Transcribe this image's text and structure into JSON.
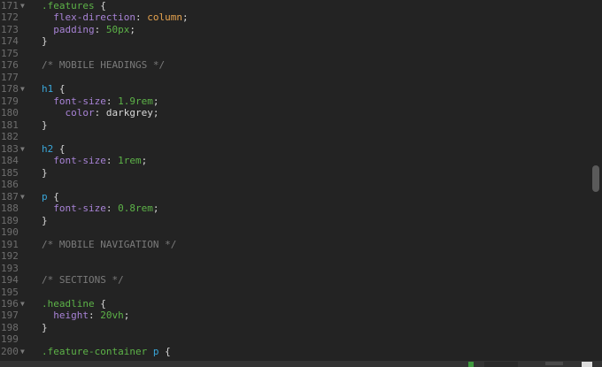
{
  "editor": {
    "lines": [
      {
        "n": "171",
        "fold": true,
        "tokens": [
          [
            "sel",
            ".features"
          ],
          [
            "pn",
            " {"
          ]
        ]
      },
      {
        "n": "172",
        "tokens": [
          [
            "pn",
            "  "
          ],
          [
            "prop",
            "flex-direction"
          ],
          [
            "pn",
            ": "
          ],
          [
            "kw",
            "column"
          ],
          [
            "pn",
            ";"
          ]
        ]
      },
      {
        "n": "173",
        "tokens": [
          [
            "pn",
            "  "
          ],
          [
            "prop",
            "padding"
          ],
          [
            "pn",
            ": "
          ],
          [
            "num",
            "50px"
          ],
          [
            "pn",
            ";"
          ]
        ]
      },
      {
        "n": "174",
        "tokens": [
          [
            "pn",
            "}"
          ]
        ]
      },
      {
        "n": "175",
        "tokens": []
      },
      {
        "n": "176",
        "tokens": [
          [
            "cm",
            "/* MOBILE HEADINGS */"
          ]
        ]
      },
      {
        "n": "177",
        "tokens": []
      },
      {
        "n": "178",
        "fold": true,
        "tokens": [
          [
            "tag",
            "h1"
          ],
          [
            "pn",
            " {"
          ]
        ]
      },
      {
        "n": "179",
        "tokens": [
          [
            "pn",
            "  "
          ],
          [
            "prop",
            "font-size"
          ],
          [
            "pn",
            ": "
          ],
          [
            "num",
            "1.9rem"
          ],
          [
            "pn",
            ";"
          ]
        ]
      },
      {
        "n": "180",
        "tokens": [
          [
            "pn",
            "    "
          ],
          [
            "prop",
            "color"
          ],
          [
            "pn",
            ": darkgrey;"
          ]
        ]
      },
      {
        "n": "181",
        "tokens": [
          [
            "pn",
            "}"
          ]
        ]
      },
      {
        "n": "182",
        "tokens": []
      },
      {
        "n": "183",
        "fold": true,
        "tokens": [
          [
            "tag",
            "h2"
          ],
          [
            "pn",
            " {"
          ]
        ]
      },
      {
        "n": "184",
        "tokens": [
          [
            "pn",
            "  "
          ],
          [
            "prop",
            "font-size"
          ],
          [
            "pn",
            ": "
          ],
          [
            "num",
            "1rem"
          ],
          [
            "pn",
            ";"
          ]
        ]
      },
      {
        "n": "185",
        "tokens": [
          [
            "pn",
            "}"
          ]
        ]
      },
      {
        "n": "186",
        "tokens": []
      },
      {
        "n": "187",
        "fold": true,
        "tokens": [
          [
            "tag",
            "p"
          ],
          [
            "pn",
            " {"
          ]
        ]
      },
      {
        "n": "188",
        "tokens": [
          [
            "pn",
            "  "
          ],
          [
            "prop",
            "font-size"
          ],
          [
            "pn",
            ": "
          ],
          [
            "num",
            "0.8rem"
          ],
          [
            "pn",
            ";"
          ]
        ]
      },
      {
        "n": "189",
        "tokens": [
          [
            "pn",
            "}"
          ]
        ]
      },
      {
        "n": "190",
        "tokens": []
      },
      {
        "n": "191",
        "tokens": [
          [
            "cm",
            "/* MOBILE NAVIGATION */"
          ]
        ]
      },
      {
        "n": "192",
        "tokens": []
      },
      {
        "n": "193",
        "tokens": []
      },
      {
        "n": "194",
        "tokens": [
          [
            "cm",
            "/* SECTIONS */"
          ]
        ]
      },
      {
        "n": "195",
        "tokens": []
      },
      {
        "n": "196",
        "fold": true,
        "tokens": [
          [
            "sel",
            ".headline"
          ],
          [
            "pn",
            " {"
          ]
        ]
      },
      {
        "n": "197",
        "tokens": [
          [
            "pn",
            "  "
          ],
          [
            "prop",
            "height"
          ],
          [
            "pn",
            ": "
          ],
          [
            "num",
            "20vh"
          ],
          [
            "pn",
            ";"
          ]
        ]
      },
      {
        "n": "198",
        "tokens": [
          [
            "pn",
            "}"
          ]
        ]
      },
      {
        "n": "199",
        "tokens": []
      },
      {
        "n": "200",
        "fold": true,
        "tokens": [
          [
            "sel",
            ".feature-container"
          ],
          [
            "pn",
            " "
          ],
          [
            "tag",
            "p"
          ],
          [
            "pn",
            " {"
          ]
        ]
      }
    ]
  },
  "colors": {
    "background": "#232323",
    "selector": "#5db348",
    "property": "#a883d6",
    "keyword": "#e5a24e",
    "tag": "#39a6d8",
    "comment": "#7a7a7a"
  }
}
